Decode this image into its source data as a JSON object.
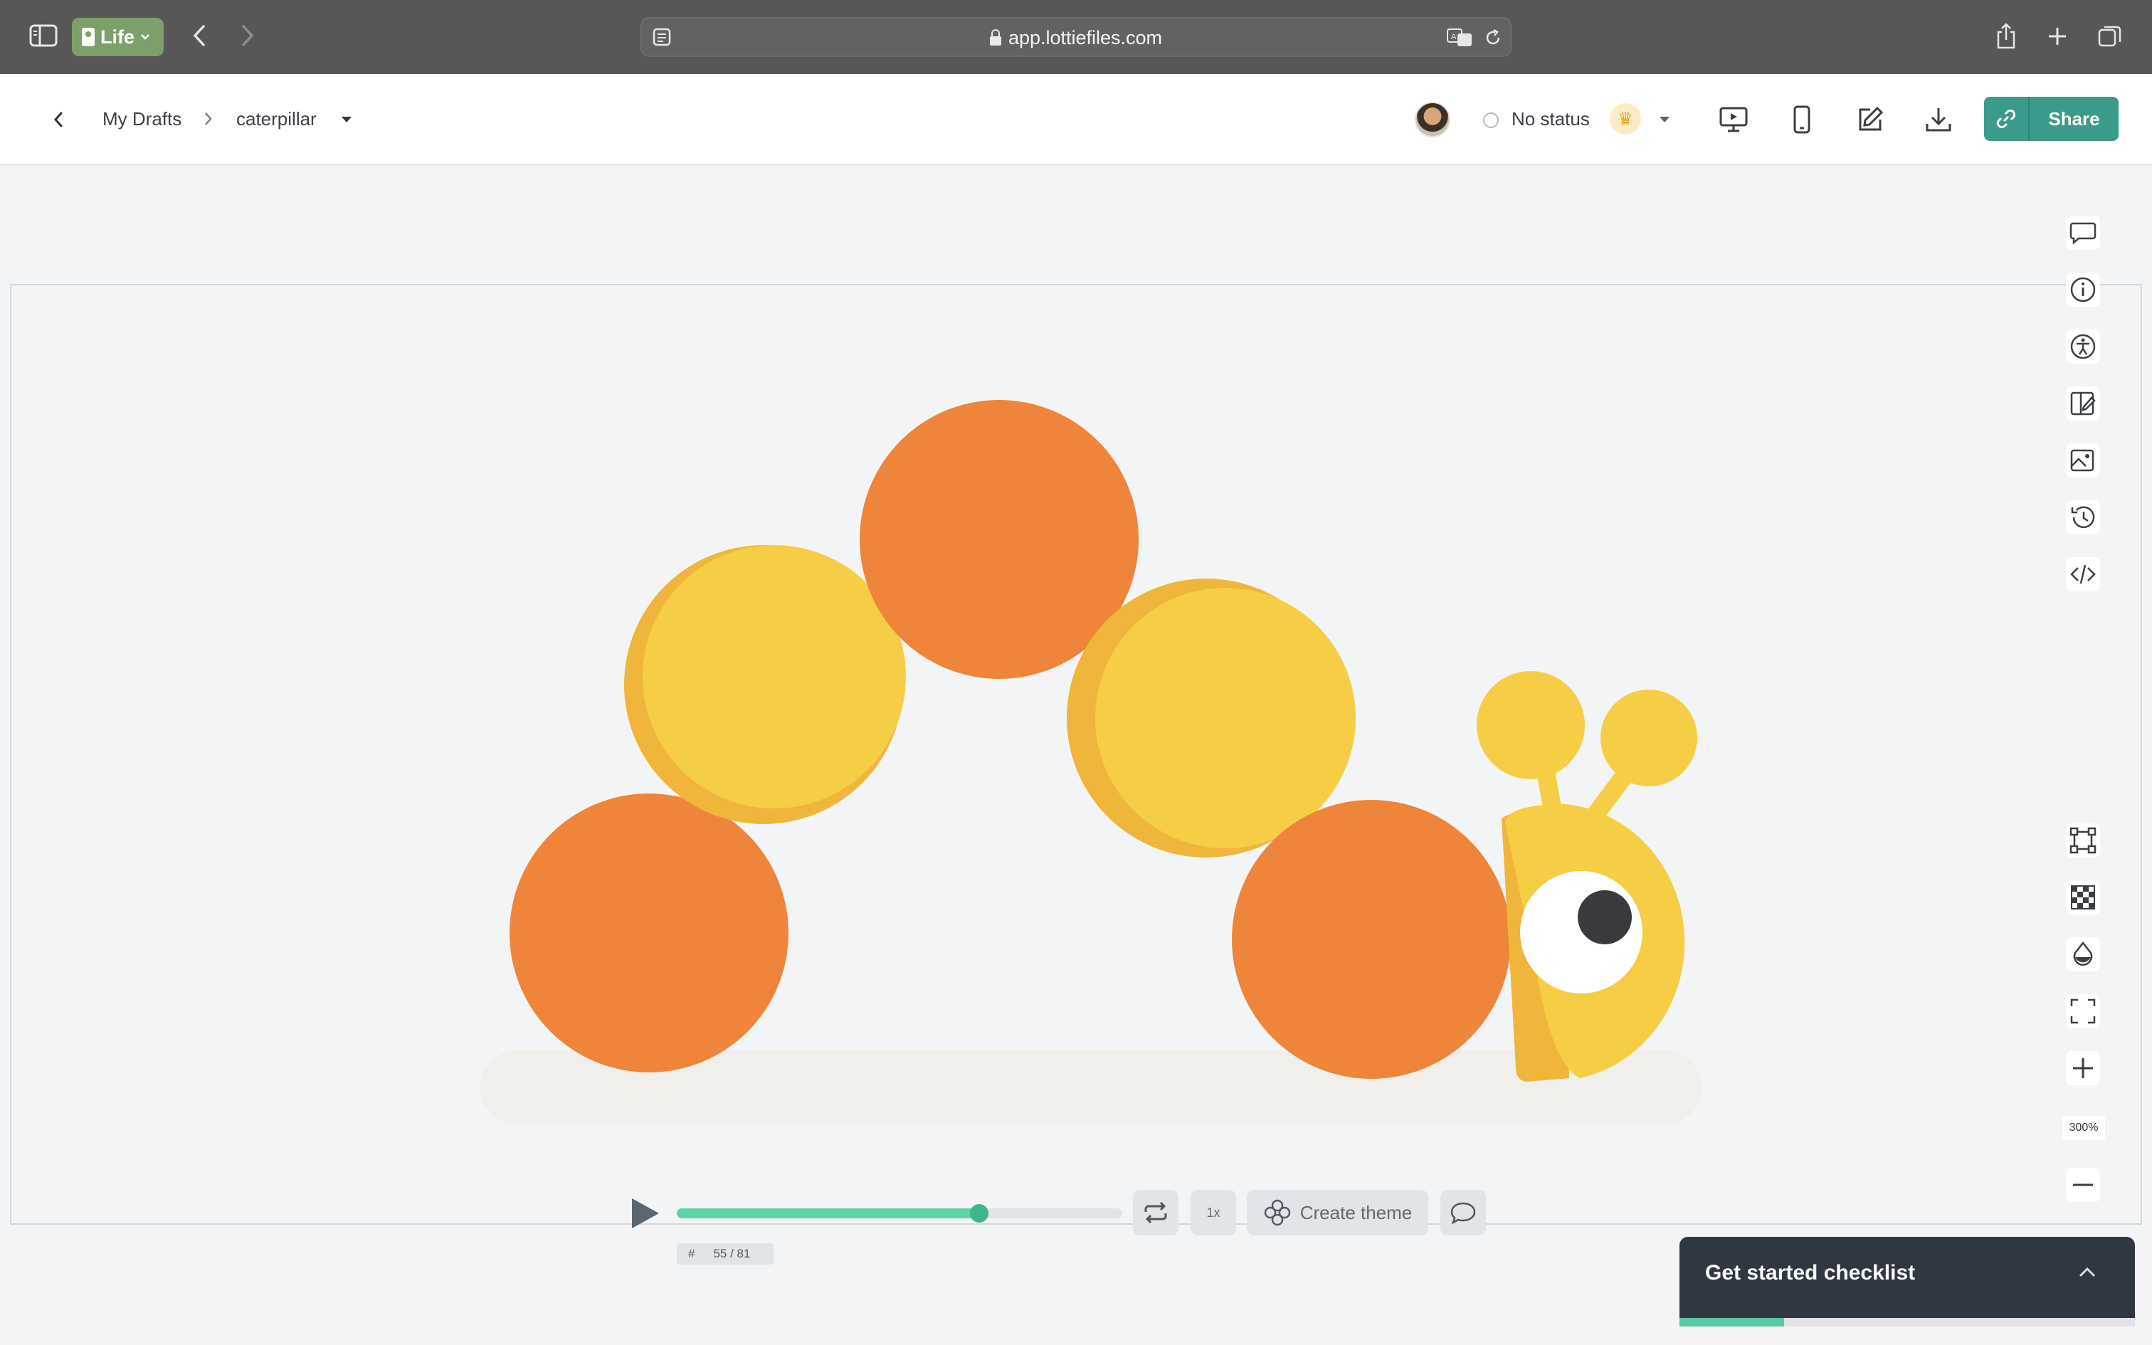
{
  "browser": {
    "profile_label": "Life",
    "url": "app.lottiefiles.com"
  },
  "header": {
    "breadcrumb_root": "My Drafts",
    "file_name": "caterpillar",
    "status_label": "No status",
    "share_label": "Share"
  },
  "toolbar": {
    "zoom_label": "300%"
  },
  "player": {
    "frame_hash": "#",
    "frame_value": "55 / 81",
    "current_frame": 55,
    "total_frames": 81,
    "speed_label": "1x",
    "create_theme_label": "Create theme"
  },
  "checklist": {
    "title": "Get started checklist",
    "progress_fraction": 0.23
  },
  "colors": {
    "brand": "#3b9b8a",
    "progress": "#5fd3a8",
    "orange": "#ee853a",
    "yellow": "#f6ce46"
  }
}
